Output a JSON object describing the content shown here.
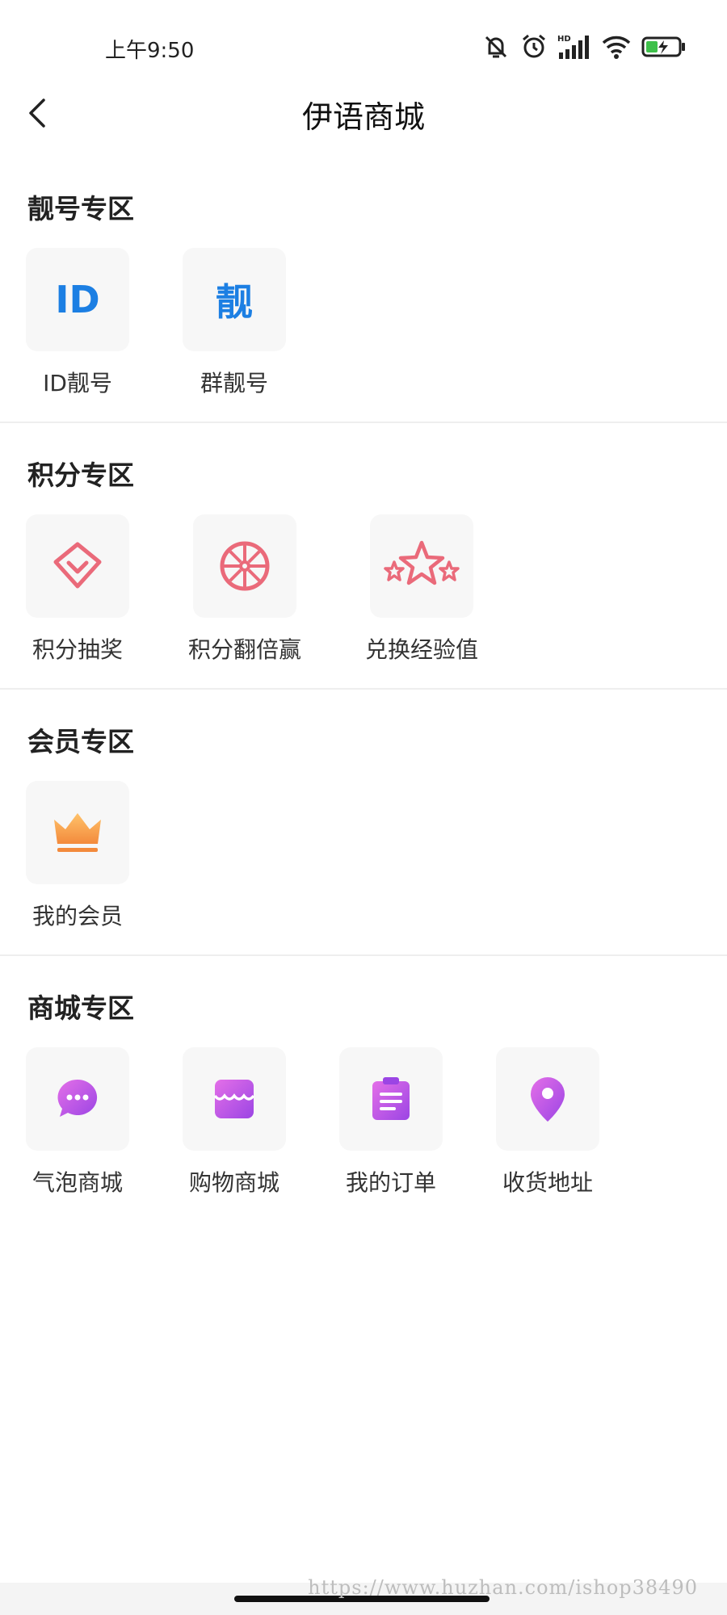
{
  "status_bar": {
    "time": "上午9:50",
    "icons": [
      "mute-bell-icon",
      "alarm-icon",
      "hd-signal-icon",
      "wifi-icon",
      "battery-charging-icon"
    ],
    "hd_label": "HD"
  },
  "header": {
    "title": "伊语商城",
    "back_icon": "chevron-left-icon"
  },
  "sections": [
    {
      "title": "靓号专区",
      "items": [
        {
          "label": "ID靓号",
          "icon": "id-text-icon",
          "icon_text": "ID"
        },
        {
          "label": "群靓号",
          "icon": "liang-text-icon",
          "icon_text": "靓"
        }
      ]
    },
    {
      "title": "积分专区",
      "items": [
        {
          "label": "积分抽奖",
          "icon": "diamond-icon"
        },
        {
          "label": "积分翻倍赢",
          "icon": "wheel-icon"
        },
        {
          "label": "兑换经验值",
          "icon": "stars-icon"
        }
      ]
    },
    {
      "title": "会员专区",
      "items": [
        {
          "label": "我的会员",
          "icon": "crown-icon"
        }
      ]
    },
    {
      "title": "商城专区",
      "items": [
        {
          "label": "气泡商城",
          "icon": "chat-bubble-icon"
        },
        {
          "label": "购物商城",
          "icon": "shop-icon"
        },
        {
          "label": "我的订单",
          "icon": "clipboard-icon"
        },
        {
          "label": "收货地址",
          "icon": "location-pin-icon"
        }
      ]
    }
  ],
  "colors": {
    "blue": "#1c7fe3",
    "pink": "#ea6a7a",
    "orange": "#f6a04d",
    "purple": "#c25be6"
  },
  "watermark": "https://www.huzhan.com/ishop38490"
}
